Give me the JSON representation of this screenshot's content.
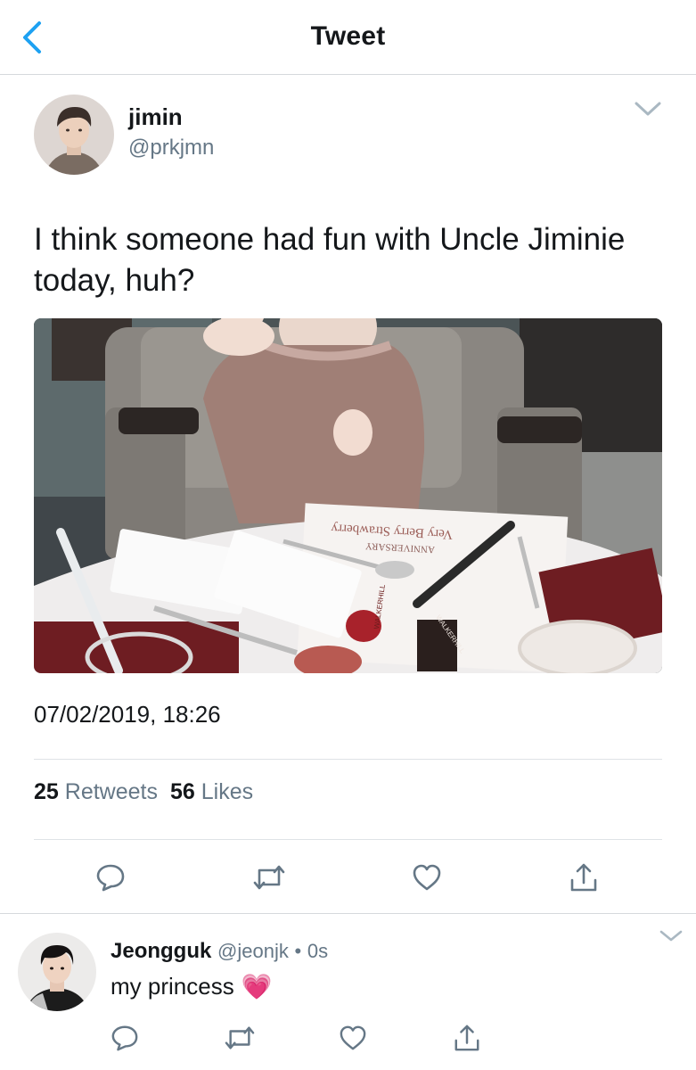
{
  "nav": {
    "title": "Tweet",
    "back_icon": "chevron-left-icon"
  },
  "tweet": {
    "author_name": "jimin",
    "author_handle": "@prkjmn",
    "text": "I think someone had fun with Uncle Jiminie today, huh?",
    "timestamp": "07/02/2019, 18:26",
    "retweets_count": "25",
    "retweets_label": "Retweets",
    "likes_count": "56",
    "likes_label": "Likes",
    "photo_text": {
      "menu_line_1": "ANNIVERSARY",
      "menu_line_2": "Very Berry Strawberry",
      "tag_1": "WALKERHILL",
      "tag_2": "WALKERHILL"
    }
  },
  "reply": {
    "author_name": "Jeongguk",
    "author_handle": "@jeonjk",
    "separator": "•",
    "time": "0s",
    "text": "my princess",
    "emoji": "💗"
  },
  "icons": {
    "reply": "speech-bubble-icon",
    "retweet": "retweet-icon",
    "like": "heart-icon",
    "share": "share-icon",
    "more": "chevron-down-icon"
  },
  "colors": {
    "accent": "#1da1f2",
    "icon_gray": "#657786",
    "divider": "#dfe3e6"
  }
}
